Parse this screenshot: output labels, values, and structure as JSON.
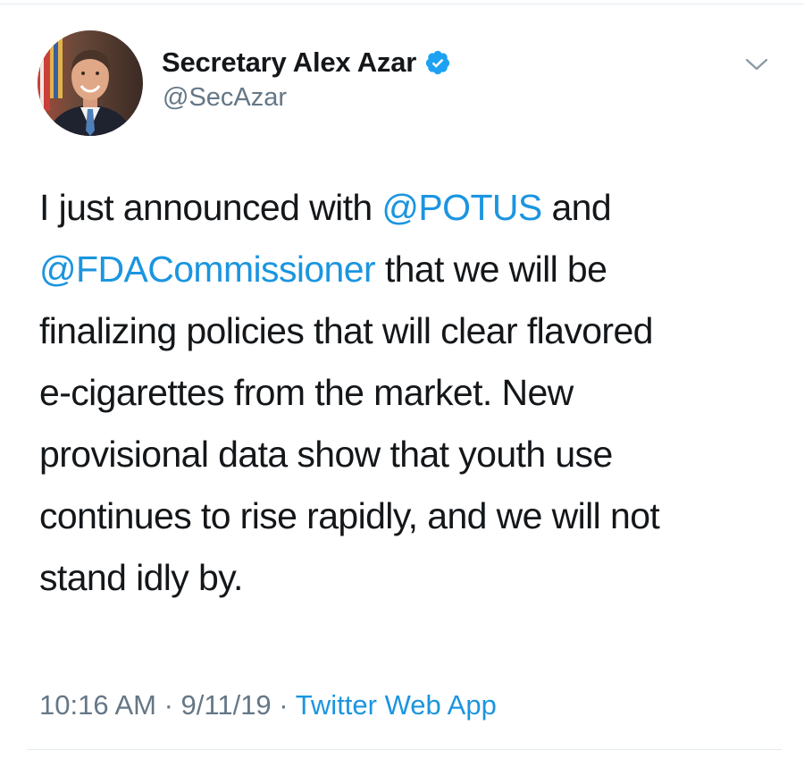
{
  "tweet": {
    "author": {
      "display_name": "Secretary Alex Azar",
      "handle": "@SecAzar",
      "verified": true,
      "verified_icon": "verified-badge-icon"
    },
    "menu_icon": "chevron-down-icon",
    "body": {
      "line1": {
        "pre": "I just announced with ",
        "mention": "@POTUS",
        "post": " and"
      },
      "line2": {
        "mention": "@FDACommissioner",
        "post": " that we will be"
      },
      "line3": "finalizing policies that will clear flavored",
      "line4": "e-cigarettes from the market. New",
      "line5": "provisional data show that youth use",
      "line6": "continues to rise rapidly, and we will not",
      "line7": "stand idly by."
    },
    "meta": {
      "time": "10:16 AM",
      "separator": " · ",
      "date": "9/11/19",
      "source": "Twitter Web App"
    }
  },
  "colors": {
    "text": "#14171a",
    "secondary": "#657786",
    "link": "#1b95e0",
    "verified": "#1da1f2",
    "divider": "#e6ecf0"
  }
}
